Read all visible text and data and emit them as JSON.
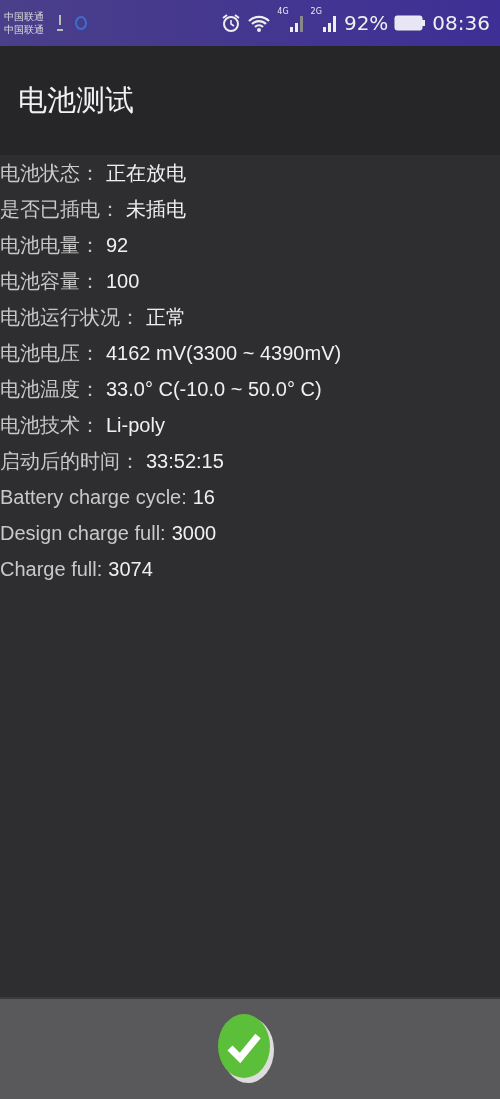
{
  "status_bar": {
    "carriers": [
      "中国联通",
      "中国联通"
    ],
    "network_labels": [
      "4G",
      "2G"
    ],
    "battery_percent": "92%",
    "time": "08:36"
  },
  "app_bar": {
    "title": "电池测试"
  },
  "info_rows": [
    {
      "label": "电池状态：",
      "value": "正在放电"
    },
    {
      "label": "是否已插电：",
      "value": "未插电"
    },
    {
      "label": "电池电量：",
      "value": "92"
    },
    {
      "label": "电池容量：",
      "value": "100"
    },
    {
      "label": "电池运行状况：",
      "value": "正常"
    },
    {
      "label": "电池电压：",
      "value": "4162 mV(3300 ~ 4390mV)"
    },
    {
      "label": "电池温度：",
      "value": "33.0° C(-10.0 ~ 50.0° C)"
    },
    {
      "label": "电池技术：",
      "value": "Li-poly"
    },
    {
      "label": "启动后的时间：",
      "value": "33:52:15"
    },
    {
      "label": "Battery charge cycle:",
      "value": "16"
    },
    {
      "label": "Design charge full:",
      "value": "3000"
    },
    {
      "label": "Charge full:",
      "value": "3074"
    }
  ]
}
